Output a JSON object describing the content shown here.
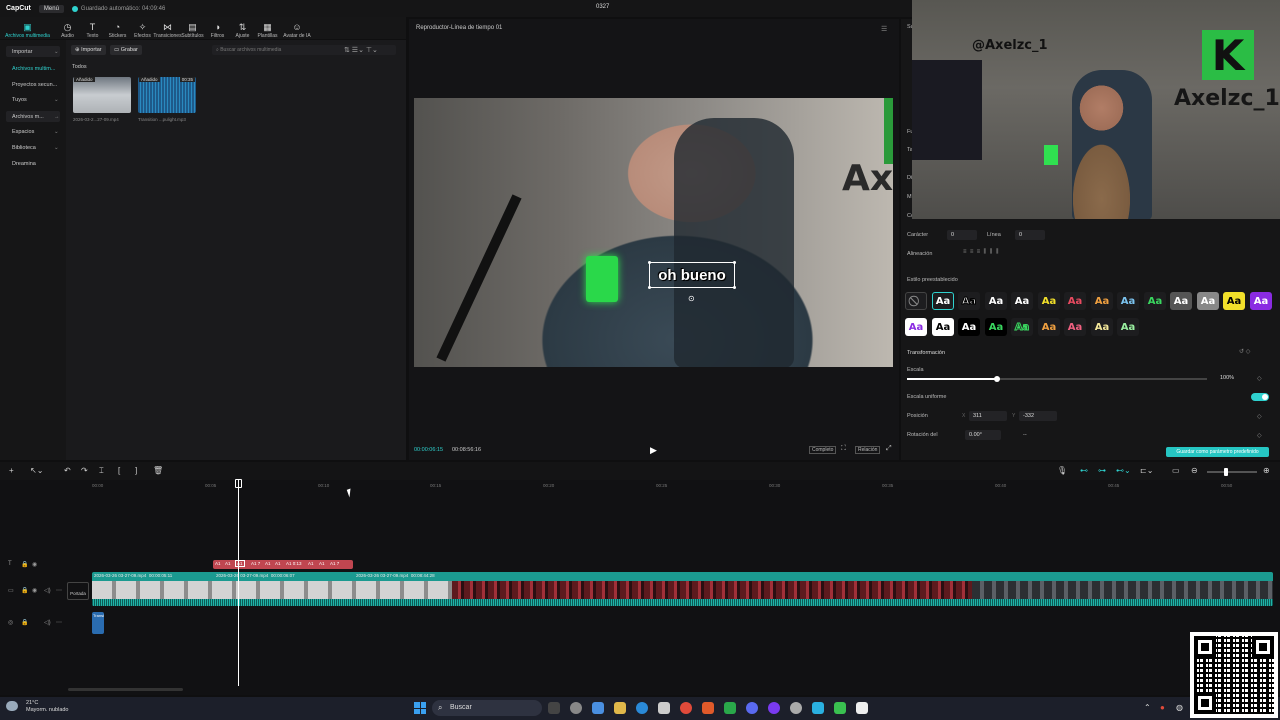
{
  "titlebar": {
    "app": "CapCut",
    "menu": "Menú",
    "autosave": "Guardado automático: 04:09:46",
    "project": "0327"
  },
  "toolbar": {
    "items": [
      {
        "label": "Archivos multimedia",
        "icon": "media-icon"
      },
      {
        "label": "Audio",
        "icon": "audio-icon"
      },
      {
        "label": "Texto",
        "icon": "text-icon"
      },
      {
        "label": "Stickers",
        "icon": "sticker-icon"
      },
      {
        "label": "Efectos",
        "icon": "effects-icon"
      },
      {
        "label": "Transiciones",
        "icon": "transitions-icon"
      },
      {
        "label": "Subtítulos",
        "icon": "subtitles-icon"
      },
      {
        "label": "Filtros",
        "icon": "filters-icon"
      },
      {
        "label": "Ajuste",
        "icon": "adjust-icon"
      },
      {
        "label": "Plantillas",
        "icon": "templates-icon"
      },
      {
        "label": "Avatar de IA",
        "icon": "ai-avatar-icon"
      }
    ]
  },
  "leftnav": {
    "items": [
      "Importar",
      "Archivos multim...",
      "Proyectos secun...",
      "Tuyos",
      "Archivos m...",
      "Espacios",
      "Biblioteca",
      "Dreamina"
    ]
  },
  "media": {
    "import": "Importar",
    "record": "Grabar",
    "search_placeholder": "Buscar archivos multimedia",
    "section": "Todos",
    "files": [
      {
        "tag": "Añadido",
        "name": "2026-03-2...27-09.mp4",
        "duration": ""
      },
      {
        "tag": "Añadido",
        "name": "Transition ...pulight.mp3",
        "duration": "00:35"
      }
    ]
  },
  "player": {
    "title": "Reproductor-Línea de tiempo 01",
    "caption": "oh bueno",
    "wall_text": "Ax",
    "current": "00:00:06:15",
    "total": "00:08:56:16",
    "btn_full": "Completo",
    "btn_ratio": "Relación"
  },
  "webcam": {
    "handle": "@Axelzc_1",
    "brand_letter": "K",
    "brand_name": "Axelzc_1"
  },
  "rpanel": {
    "character_label": "Carácter",
    "character_value": "0",
    "line_label": "Línea",
    "line_value": "0",
    "align_label": "Alineación",
    "preset_label": "Estilo preestablecido",
    "preset_text": "Aa",
    "transform_label": "Transformación",
    "scale_label": "Escala",
    "scale_value": "100%",
    "scale_fraction": 0.3,
    "uniform_label": "Escala uniforme",
    "position_label": "Posición",
    "pos_x_label": "X",
    "pos_x": "311",
    "pos_y_label": "Y",
    "pos_y": "-332",
    "rotation_label": "Rotación del",
    "rotation_value": "0.00°",
    "rotation_extra": "--",
    "save_preset": "Guardar como parámetro predefinido",
    "side_letters": [
      "Su",
      "Fu",
      "Ta",
      "Di",
      "Mi",
      "Co"
    ]
  },
  "timeline": {
    "ruler": [
      "00:00",
      "00:05",
      "00:10",
      "00:15",
      "00:20",
      "00:25",
      "00:30",
      "00:35",
      "00:40",
      "00:45",
      "00:50"
    ],
    "text_clips": [
      "A1",
      "A1",
      "A1",
      "A1 7",
      "A1",
      "A1",
      "A1 0:13",
      "A1",
      "A1",
      "A1 7"
    ],
    "video_labels": [
      {
        "name": "2026-03-26 03-27-09.mp4",
        "dur": "00:00:05:11"
      },
      {
        "name": "2026-03-26 03-27-09.mp4",
        "dur": "00:00:06:07"
      },
      {
        "name": "2026-03-26 03-27-09.mp4",
        "dur": "00:08:44:28"
      }
    ],
    "cover": "Portada",
    "audio_clip": "Transi"
  },
  "taskbar": {
    "temp": "21°C",
    "weather": "Mayorm. nublado",
    "search": "Buscar"
  },
  "colors": {
    "accent": "#2fd2cf",
    "text_track": "#c04650",
    "video_track": "#1b9a90",
    "audio_track": "#2a6cb0"
  }
}
